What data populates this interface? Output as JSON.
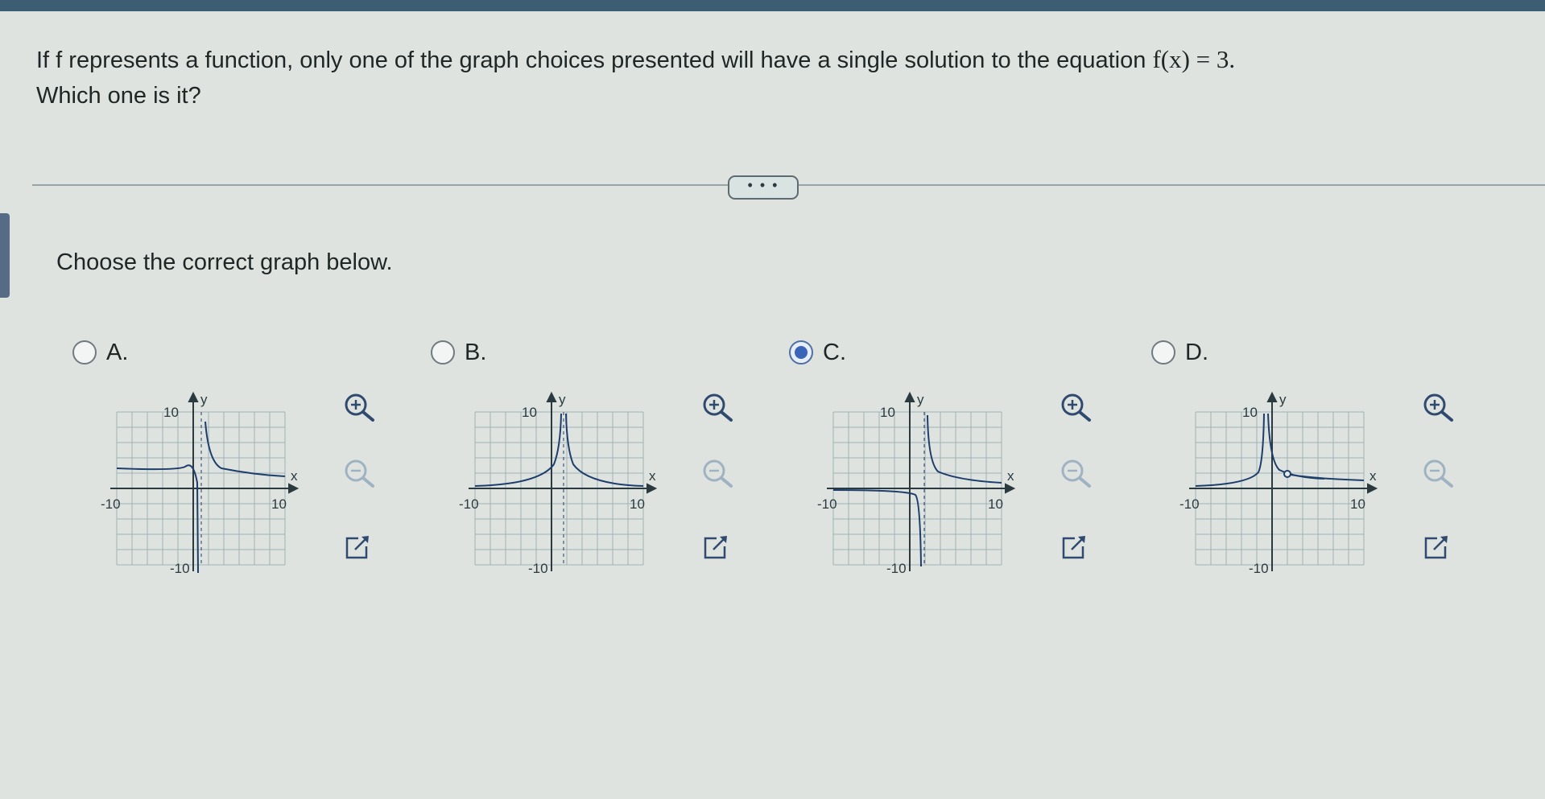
{
  "question": {
    "line1": "If f represents a function, only one of the graph choices presented will have a single solution to the equation",
    "equation": "f(x) = 3.",
    "line2": "Which one is it?"
  },
  "more_button": "• • •",
  "instruction": "Choose the correct graph below.",
  "selected_option": "C",
  "options": [
    {
      "label": "A.",
      "axis": {
        "y_label": "y",
        "x_label": "x",
        "y_top": "10",
        "y_bottom": "-10",
        "x_left": "-10",
        "x_right": "10"
      }
    },
    {
      "label": "B.",
      "axis": {
        "y_label": "y",
        "x_label": "x",
        "y_top": "10",
        "y_bottom": "-10",
        "x_left": "-10",
        "x_right": "10"
      }
    },
    {
      "label": "C.",
      "axis": {
        "y_label": "y",
        "x_label": "x",
        "y_top": "10",
        "y_bottom": "-10",
        "x_left": "-10",
        "x_right": "10"
      }
    },
    {
      "label": "D.",
      "axis": {
        "y_label": "y",
        "x_label": "x",
        "y_top": "10",
        "y_bottom": "-10",
        "x_left": "-10",
        "x_right": "10"
      }
    }
  ],
  "icons": {
    "zoom_in": "zoom-in-icon",
    "zoom_out": "zoom-out-icon",
    "popout": "external-link-icon"
  },
  "colors": {
    "topbar": "#3d5d73",
    "curve": "#1d3d6b",
    "grid": "#9fb0b3",
    "radio_selected": "#3a64b8"
  }
}
